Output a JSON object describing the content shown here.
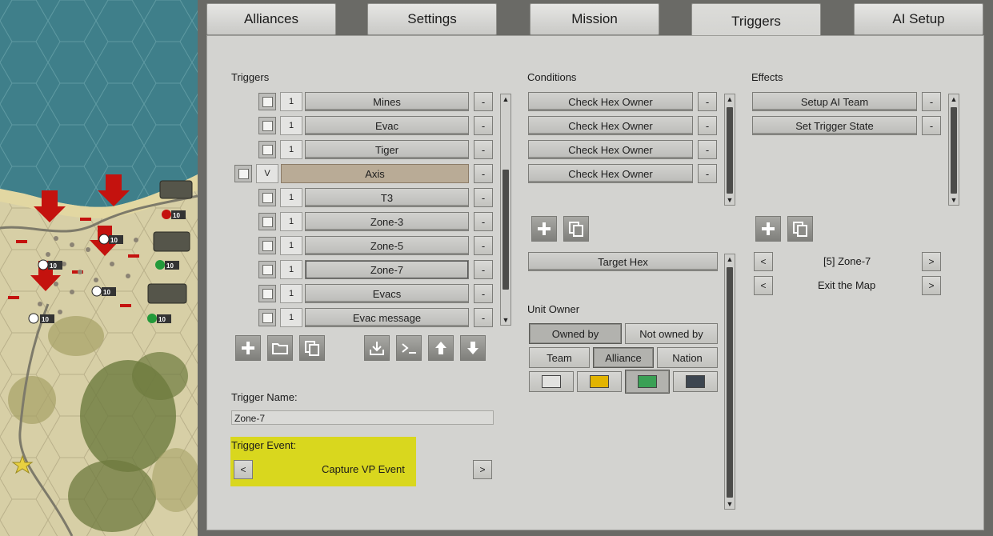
{
  "tabs": [
    {
      "label": "Alliances"
    },
    {
      "label": "Settings"
    },
    {
      "label": "Mission"
    },
    {
      "label": "Triggers",
      "active": true
    },
    {
      "label": "AI Setup"
    }
  ],
  "triggers": {
    "heading": "Triggers",
    "items": [
      {
        "count": "1",
        "name": "Mines"
      },
      {
        "count": "1",
        "name": "Evac"
      },
      {
        "count": "1",
        "name": "Tiger"
      },
      {
        "count": "V",
        "name": "Axis",
        "selected_group": true
      },
      {
        "count": "1",
        "name": "T3"
      },
      {
        "count": "1",
        "name": "Zone-3"
      },
      {
        "count": "1",
        "name": "Zone-5"
      },
      {
        "count": "1",
        "name": "Zone-7"
      },
      {
        "count": "1",
        "name": "Evacs"
      },
      {
        "count": "1",
        "name": "Evac message"
      }
    ],
    "remove_label": "-",
    "toolbar_icons": [
      "add-icon",
      "folder-icon",
      "copy-icon",
      "import-icon",
      "console-icon",
      "move-up-icon",
      "move-down-icon"
    ],
    "name_label": "Trigger Name:",
    "name_value": "Zone-7",
    "event_label": "Trigger Event:",
    "event_value": "Capture VP Event",
    "prev": "<",
    "next": ">",
    "event_highlight_color": "#d9d71e"
  },
  "conditions": {
    "heading": "Conditions",
    "items": [
      {
        "name": "Check Hex Owner"
      },
      {
        "name": "Check Hex Owner"
      },
      {
        "name": "Check Hex Owner"
      },
      {
        "name": "Check Hex Owner"
      }
    ],
    "target_hex": "Target Hex",
    "unit_owner_label": "Unit Owner",
    "owned_by": "Owned by",
    "not_owned_by": "Not owned by",
    "team": "Team",
    "alliance": "Alliance",
    "nation": "Nation",
    "swatches": [
      "#e2e2e0",
      "#e2b400",
      "#3aa055",
      "#3d4650"
    ]
  },
  "effects": {
    "heading": "Effects",
    "items": [
      {
        "name": "Setup AI Team"
      },
      {
        "name": "Set Trigger State"
      }
    ],
    "param1": "[5] Zone-7",
    "param2": "Exit the Map"
  },
  "map": {
    "badges": [
      "10",
      "10",
      "10",
      "10",
      "10",
      "10",
      "10",
      "10"
    ]
  },
  "colors": {
    "panel_bg": "#d3d3d0",
    "sea": "#3f7f8a",
    "axis_marker": "#c4120e"
  }
}
